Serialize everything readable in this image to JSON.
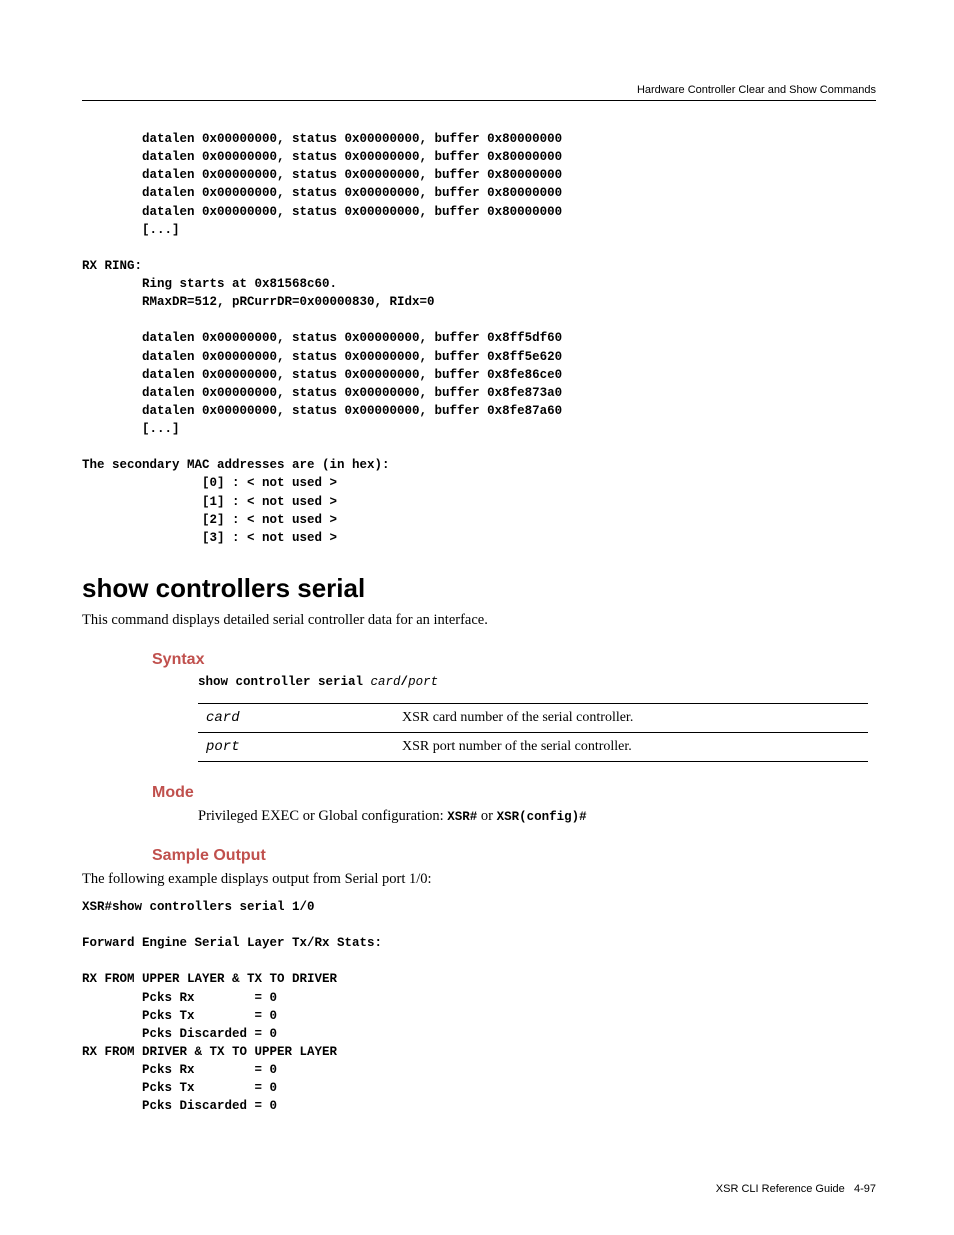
{
  "running_head": "Hardware Controller Clear and Show Commands",
  "top_output": "        datalen 0x00000000, status 0x00000000, buffer 0x80000000\n        datalen 0x00000000, status 0x00000000, buffer 0x80000000\n        datalen 0x00000000, status 0x00000000, buffer 0x80000000\n        datalen 0x00000000, status 0x00000000, buffer 0x80000000\n        datalen 0x00000000, status 0x00000000, buffer 0x80000000\n        [...]\n\nRX RING:\n        Ring starts at 0x81568c60.\n        RMaxDR=512, pRCurrDR=0x00000830, RIdx=0\n\n        datalen 0x00000000, status 0x00000000, buffer 0x8ff5df60\n        datalen 0x00000000, status 0x00000000, buffer 0x8ff5e620\n        datalen 0x00000000, status 0x00000000, buffer 0x8fe86ce0\n        datalen 0x00000000, status 0x00000000, buffer 0x8fe873a0\n        datalen 0x00000000, status 0x00000000, buffer 0x8fe87a60\n        [...]\n\nThe secondary MAC addresses are (in hex):\n                [0] : < not used >\n                [1] : < not used >\n                [2] : < not used >\n                [3] : < not used >",
  "section": {
    "title": "show controllers serial",
    "intro": "This command displays detailed serial controller data for an interface.",
    "syntax_heading": "Syntax",
    "syntax_kw": "show controller serial ",
    "syntax_arg1": "card",
    "syntax_slash": "/",
    "syntax_arg2": "port",
    "params": [
      {
        "name": "card",
        "desc": "XSR card number of the serial controller."
      },
      {
        "name": "port",
        "desc": "XSR port number of the serial controller."
      }
    ],
    "mode_heading": "Mode",
    "mode_prefix": "Privileged EXEC or Global configuration: ",
    "mode_code1": "XSR#",
    "mode_or": "  or  ",
    "mode_code2": "XSR(config)#",
    "sample_heading": "Sample Output",
    "sample_intro": "The following example displays output from Serial port 1/0:",
    "sample_output": "XSR#show controllers serial 1/0\n\nForward Engine Serial Layer Tx/Rx Stats:\n\nRX FROM UPPER LAYER & TX TO DRIVER\n        Pcks Rx        = 0\n        Pcks Tx        = 0\n        Pcks Discarded = 0\nRX FROM DRIVER & TX TO UPPER LAYER\n        Pcks Rx        = 0\n        Pcks Tx        = 0\n        Pcks Discarded = 0"
  },
  "footer": {
    "guide": "XSR CLI Reference Guide",
    "page": "4-97"
  }
}
